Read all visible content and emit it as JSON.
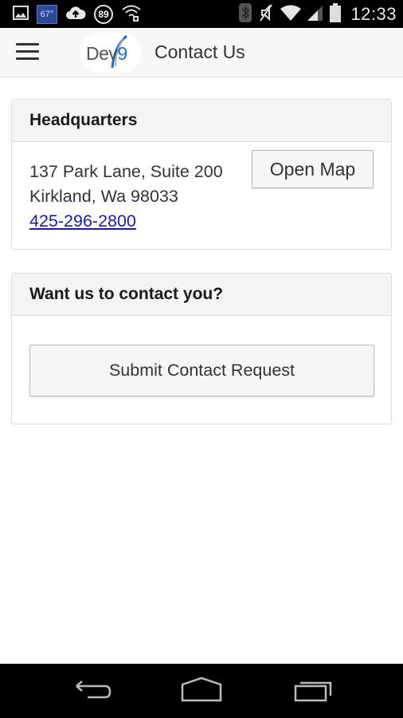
{
  "status_bar": {
    "weather_temp": "67°",
    "notification_count": "89",
    "time": "12:33",
    "icons_left": [
      "gallery-icon",
      "weather-icon",
      "cloud-upload-icon",
      "notification-count-icon",
      "wifi-download-icon"
    ],
    "icons_right": [
      "bluetooth-icon",
      "mute-icon",
      "wifi-icon",
      "signal-icon",
      "battery-icon"
    ]
  },
  "action_bar": {
    "menu_icon": "hamburger-menu-icon",
    "logo": {
      "text_main": "Dev",
      "text_accent": "9",
      "accent_color": "#1f6fcf"
    },
    "title": "Contact Us"
  },
  "headquarters": {
    "title": "Headquarters",
    "address_line1": "137 Park Lane, Suite 200",
    "address_line2": "Kirkland, Wa 98033",
    "phone": "425-296-2800",
    "phone_color": "#1a1ab8",
    "open_map_label": "Open Map"
  },
  "contact_request": {
    "title": "Want us to contact you?",
    "submit_label": "Submit Contact Request"
  },
  "nav_bar": {
    "buttons": [
      "back-icon",
      "home-icon",
      "recent-apps-icon"
    ]
  }
}
